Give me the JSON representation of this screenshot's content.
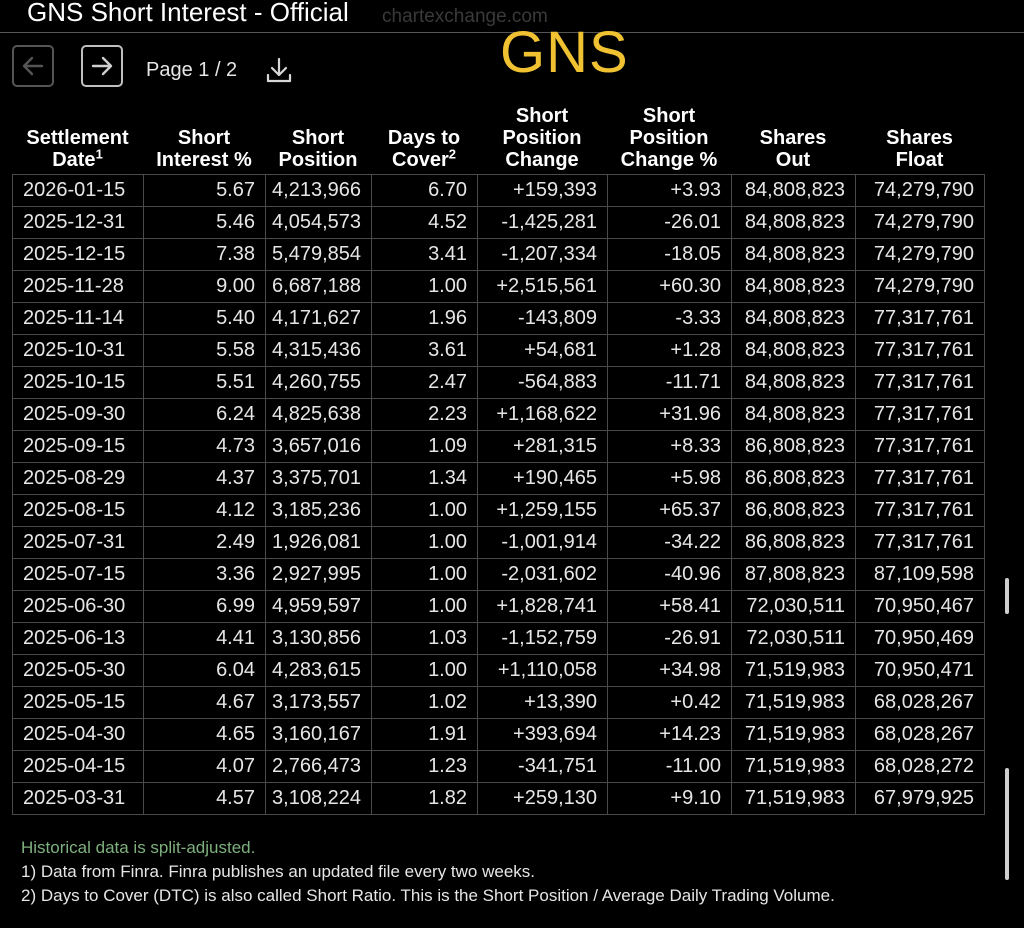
{
  "header": {
    "title": "GNS Short Interest - Official",
    "watermark": "chartexchange.com",
    "ticker": "GNS"
  },
  "pager": {
    "label": "Page 1 / 2",
    "prev_icon": "arrow-left-icon",
    "next_icon": "arrow-right-icon",
    "download_icon": "download-icon"
  },
  "table": {
    "columns": [
      {
        "lines": [
          "Settlement",
          "Date"
        ],
        "sup": "1"
      },
      {
        "lines": [
          "Short",
          "Interest %"
        ],
        "sup": ""
      },
      {
        "lines": [
          "Short",
          "Position"
        ],
        "sup": ""
      },
      {
        "lines": [
          "Days to",
          "Cover"
        ],
        "sup": "2"
      },
      {
        "lines": [
          "Short",
          "Position",
          "Change"
        ],
        "sup": ""
      },
      {
        "lines": [
          "Short",
          "Position",
          "Change %"
        ],
        "sup": ""
      },
      {
        "lines": [
          "Shares",
          "Out"
        ],
        "sup": ""
      },
      {
        "lines": [
          "Shares",
          "Float"
        ],
        "sup": ""
      }
    ],
    "rows": [
      [
        "2026-01-15",
        "5.67",
        "4,213,966",
        "6.70",
        "+159,393",
        "+3.93",
        "84,808,823",
        "74,279,790"
      ],
      [
        "2025-12-31",
        "5.46",
        "4,054,573",
        "4.52",
        "-1,425,281",
        "-26.01",
        "84,808,823",
        "74,279,790"
      ],
      [
        "2025-12-15",
        "7.38",
        "5,479,854",
        "3.41",
        "-1,207,334",
        "-18.05",
        "84,808,823",
        "74,279,790"
      ],
      [
        "2025-11-28",
        "9.00",
        "6,687,188",
        "1.00",
        "+2,515,561",
        "+60.30",
        "84,808,823",
        "74,279,790"
      ],
      [
        "2025-11-14",
        "5.40",
        "4,171,627",
        "1.96",
        "-143,809",
        "-3.33",
        "84,808,823",
        "77,317,761"
      ],
      [
        "2025-10-31",
        "5.58",
        "4,315,436",
        "3.61",
        "+54,681",
        "+1.28",
        "84,808,823",
        "77,317,761"
      ],
      [
        "2025-10-15",
        "5.51",
        "4,260,755",
        "2.47",
        "-564,883",
        "-11.71",
        "84,808,823",
        "77,317,761"
      ],
      [
        "2025-09-30",
        "6.24",
        "4,825,638",
        "2.23",
        "+1,168,622",
        "+31.96",
        "84,808,823",
        "77,317,761"
      ],
      [
        "2025-09-15",
        "4.73",
        "3,657,016",
        "1.09",
        "+281,315",
        "+8.33",
        "86,808,823",
        "77,317,761"
      ],
      [
        "2025-08-29",
        "4.37",
        "3,375,701",
        "1.34",
        "+190,465",
        "+5.98",
        "86,808,823",
        "77,317,761"
      ],
      [
        "2025-08-15",
        "4.12",
        "3,185,236",
        "1.00",
        "+1,259,155",
        "+65.37",
        "86,808,823",
        "77,317,761"
      ],
      [
        "2025-07-31",
        "2.49",
        "1,926,081",
        "1.00",
        "-1,001,914",
        "-34.22",
        "86,808,823",
        "77,317,761"
      ],
      [
        "2025-07-15",
        "3.36",
        "2,927,995",
        "1.00",
        "-2,031,602",
        "-40.96",
        "87,808,823",
        "87,109,598"
      ],
      [
        "2025-06-30",
        "6.99",
        "4,959,597",
        "1.00",
        "+1,828,741",
        "+58.41",
        "72,030,511",
        "70,950,467"
      ],
      [
        "2025-06-13",
        "4.41",
        "3,130,856",
        "1.03",
        "-1,152,759",
        "-26.91",
        "72,030,511",
        "70,950,469"
      ],
      [
        "2025-05-30",
        "6.04",
        "4,283,615",
        "1.00",
        "+1,110,058",
        "+34.98",
        "71,519,983",
        "70,950,471"
      ],
      [
        "2025-05-15",
        "4.67",
        "3,173,557",
        "1.02",
        "+13,390",
        "+0.42",
        "71,519,983",
        "68,028,267"
      ],
      [
        "2025-04-30",
        "4.65",
        "3,160,167",
        "1.91",
        "+393,694",
        "+14.23",
        "71,519,983",
        "68,028,267"
      ],
      [
        "2025-04-15",
        "4.07",
        "2,766,473",
        "1.23",
        "-341,751",
        "-11.00",
        "71,519,983",
        "68,028,272"
      ],
      [
        "2025-03-31",
        "4.57",
        "3,108,224",
        "1.82",
        "+259,130",
        "+9.10",
        "71,519,983",
        "67,979,925"
      ]
    ]
  },
  "footer": {
    "split_note": "Historical data is split-adjusted.",
    "note1": "1) Data from Finra. Finra publishes an updated file every two weeks.",
    "note2": "2) Days to Cover (DTC) is also called Short Ratio. This is the Short Position / Average Daily Trading Volume."
  },
  "colors": {
    "ticker": "#f0c232",
    "split_note": "#7eb07e",
    "background": "#000000"
  }
}
